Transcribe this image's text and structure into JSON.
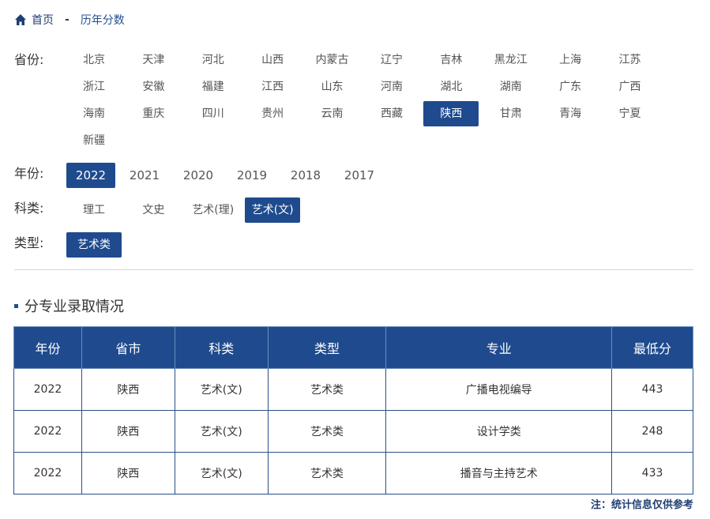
{
  "breadcrumb": {
    "home": "首页",
    "separator": "-",
    "current": "历年分数"
  },
  "filters": {
    "province": {
      "label": "省份:",
      "options": [
        "北京",
        "天津",
        "河北",
        "山西",
        "内蒙古",
        "辽宁",
        "吉林",
        "黑龙江",
        "上海",
        "江苏",
        "浙江",
        "安徽",
        "福建",
        "江西",
        "山东",
        "河南",
        "湖北",
        "湖南",
        "广东",
        "广西",
        "海南",
        "重庆",
        "四川",
        "贵州",
        "云南",
        "西藏",
        "陕西",
        "甘肃",
        "青海",
        "宁夏",
        "新疆"
      ],
      "selected": "陕西"
    },
    "year": {
      "label": "年份:",
      "options": [
        "2022",
        "2021",
        "2020",
        "2019",
        "2018",
        "2017"
      ],
      "selected": "2022"
    },
    "category": {
      "label": "科类:",
      "options": [
        "理工",
        "文史",
        "艺术(理)",
        "艺术(文)"
      ],
      "selected": "艺术(文)"
    },
    "type": {
      "label": "类型:",
      "options": [
        "艺术类"
      ],
      "selected": "艺术类"
    }
  },
  "section_title": "分专业录取情况",
  "table": {
    "headers": [
      "年份",
      "省市",
      "科类",
      "类型",
      "专业",
      "最低分"
    ],
    "rows": [
      [
        "2022",
        "陕西",
        "艺术(文)",
        "艺术类",
        "广播电视编导",
        "443"
      ],
      [
        "2022",
        "陕西",
        "艺术(文)",
        "艺术类",
        "设计学类",
        "248"
      ],
      [
        "2022",
        "陕西",
        "艺术(文)",
        "艺术类",
        "播音与主持艺术",
        "433"
      ]
    ]
  },
  "note": "注：统计信息仅供参考",
  "colors": {
    "accent": "#1f4b8e",
    "breadcrumb": "#1f3f73"
  },
  "icons": {
    "home": "home-icon"
  }
}
